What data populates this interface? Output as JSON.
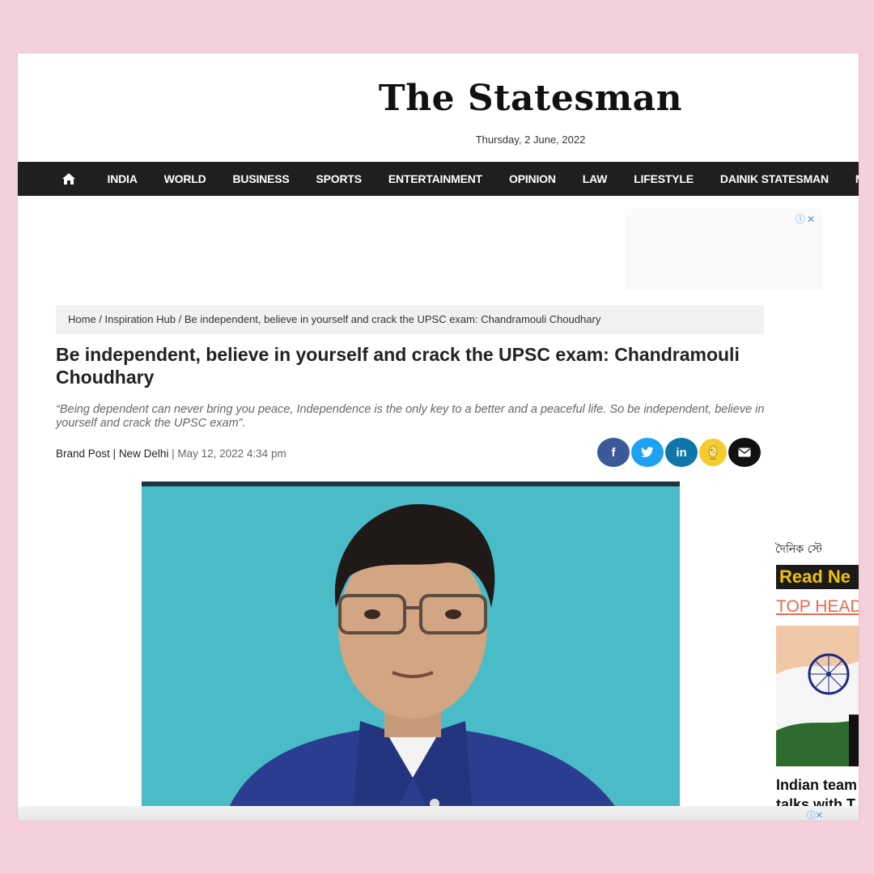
{
  "site": {
    "logo": "The Statesman",
    "date": "Thursday, 2 June, 2022"
  },
  "nav": {
    "home_icon": "home-icon",
    "items": [
      "INDIA",
      "WORLD",
      "BUSINESS",
      "SPORTS",
      "ENTERTAINMENT",
      "OPINION",
      "LAW",
      "LIFESTYLE",
      "DAINIK STATESMAN",
      "M"
    ]
  },
  "ad": {
    "icons": "ⓘ✕"
  },
  "breadcrumb": {
    "home": "Home",
    "sep1": " / ",
    "section": "Inspiration Hub",
    "sep2": " / ",
    "current": "Be independent, believe in yourself and crack the UPSC exam: Chandramouli Choudhary"
  },
  "article": {
    "title": "Be independent, believe in yourself and crack the UPSC exam: Chandramouli Choudhary",
    "quote": "“Being dependent can never bring you peace, Independence is the only key to a better and a peaceful life. So be independent, believe in yourself and crack the UPSC exam”.",
    "author": "Brand Post",
    "sep1": " | ",
    "location": "New Delhi",
    "sep2": " | ",
    "datetime": "May 12, 2022 4:34 pm"
  },
  "share": {
    "facebook": "f",
    "twitter": "twitter-icon",
    "linkedin": "in",
    "koo": "koo-icon",
    "email": "email-icon",
    "colors": {
      "facebook": "#3b5998",
      "twitter": "#1da1f2",
      "linkedin": "#0e76a8",
      "koo": "#f5cc2e",
      "email": "#111111"
    }
  },
  "sidebar": {
    "logo_text": "দৈনিক স্টে",
    "read_label": "Read Ne",
    "top_heading": "TOP HEAD",
    "headline": "Indian team talks with T"
  },
  "footer_ad": {
    "icons": "ⓘ✕"
  }
}
